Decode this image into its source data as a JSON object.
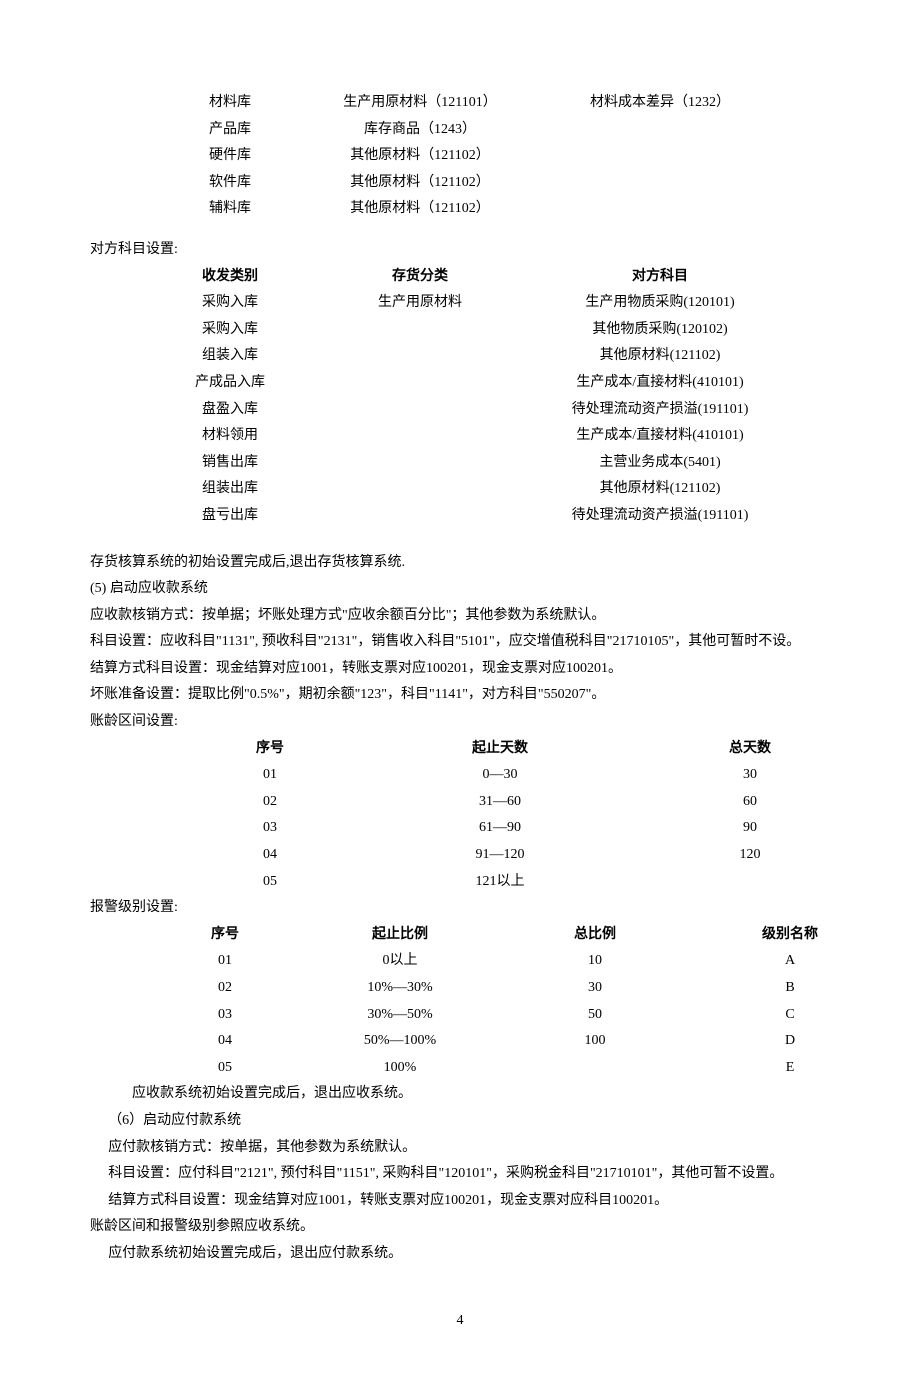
{
  "warehouse_table": {
    "rows": [
      {
        "c1": "材料库",
        "c2": "生产用原材料（121101）",
        "c3": "材料成本差异（1232）"
      },
      {
        "c1": "产品库",
        "c2": "库存商品（1243）",
        "c3": ""
      },
      {
        "c1": "硬件库",
        "c2": "其他原材料（121102）",
        "c3": ""
      },
      {
        "c1": "软件库",
        "c2": "其他原材料（121102）",
        "c3": ""
      },
      {
        "c1": "辅料库",
        "c2": "其他原材料（121102）",
        "c3": ""
      }
    ]
  },
  "counter_subject_label": "对方科目设置:",
  "counter_table": {
    "header": {
      "c1": "收发类别",
      "c2": "存货分类",
      "c3": "对方科目"
    },
    "rows": [
      {
        "c1": "采购入库",
        "c2": "生产用原材料",
        "c3": "生产用物质采购(120101)"
      },
      {
        "c1": "采购入库",
        "c2": "",
        "c3": "其他物质采购(120102)"
      },
      {
        "c1": "组装入库",
        "c2": "",
        "c3": "其他原材料(121102)"
      },
      {
        "c1": "产成品入库",
        "c2": "",
        "c3": "生产成本/直接材料(410101)"
      },
      {
        "c1": "盘盈入库",
        "c2": "",
        "c3": "待处理流动资产损溢(191101)"
      },
      {
        "c1": "材料领用",
        "c2": "",
        "c3": "生产成本/直接材料(410101)"
      },
      {
        "c1": "销售出库",
        "c2": "",
        "c3": "主营业务成本(5401)"
      },
      {
        "c1": "组装出库",
        "c2": "",
        "c3": "其他原材料(121102)"
      },
      {
        "c1": "盘亏出库",
        "c2": "",
        "c3": "待处理流动资产损溢(191101)"
      }
    ]
  },
  "inventory_exit": "存货核算系统的初始设置完成后,退出存货核算系统.",
  "section5_title": "(5)   启动应收款系统",
  "section5_p1": "应收款核销方式：按单据；坏账处理方式\"应收余额百分比\"；其他参数为系统默认。",
  "section5_p2": "科目设置：应收科目\"1131\", 预收科目\"2131\"，销售收入科目\"5101\"，应交增值税科目\"21710105\"，其他可暂时不设。",
  "section5_p3": "结算方式科目设置：现金结算对应1001，转账支票对应100201，现金支票对应100201。",
  "section5_p4": "坏账准备设置：提取比例\"0.5%\"，期初余额\"123\"，科目\"1141\"，对方科目\"550207\"。",
  "aging_label": "账龄区间设置:",
  "aging_table": {
    "header": {
      "a1": "序号",
      "a2": "起止天数",
      "a3": "总天数"
    },
    "rows": [
      {
        "a1": "01",
        "a2": "0—30",
        "a3": "30"
      },
      {
        "a1": "02",
        "a2": "31—60",
        "a3": "60"
      },
      {
        "a1": "03",
        "a2": "61—90",
        "a3": "90"
      },
      {
        "a1": "04",
        "a2": "91—120",
        "a3": "120"
      },
      {
        "a1": "05",
        "a2": "121以上",
        "a3": ""
      }
    ]
  },
  "alarm_label": "报警级别设置:",
  "alarm_table": {
    "header": {
      "b1": "序号",
      "b2": "起止比例",
      "b3": "总比例",
      "b4": "级别名称"
    },
    "rows": [
      {
        "b1": "01",
        "b2": "0以上",
        "b3": "10",
        "b4": "A"
      },
      {
        "b1": "02",
        "b2": "10%—30%",
        "b3": "30",
        "b4": "B"
      },
      {
        "b1": "03",
        "b2": "30%—50%",
        "b3": "50",
        "b4": "C"
      },
      {
        "b1": "04",
        "b2": "50%—100%",
        "b3": "100",
        "b4": "D"
      },
      {
        "b1": "05",
        "b2": "100%",
        "b3": "",
        "b4": "E"
      }
    ]
  },
  "section5_exit": "应收款系统初始设置完成后，退出应收系统。",
  "section6_title": "（6）启动应付款系统",
  "section6_p1": "应付款核销方式：按单据，其他参数为系统默认。",
  "section6_p2": "科目设置：应付科目\"2121\", 预付科目\"1151\", 采购科目\"120101\"，采购税金科目\"21710101\"，其他可暂不设置。",
  "section6_p3": "结算方式科目设置：现金结算对应1001，转账支票对应100201，现金支票对应科目100201。",
  "section6_p4": "账龄区间和报警级别参照应收系统。",
  "section6_p5": "应付款系统初始设置完成后，退出应付款系统。",
  "page_number": "4"
}
